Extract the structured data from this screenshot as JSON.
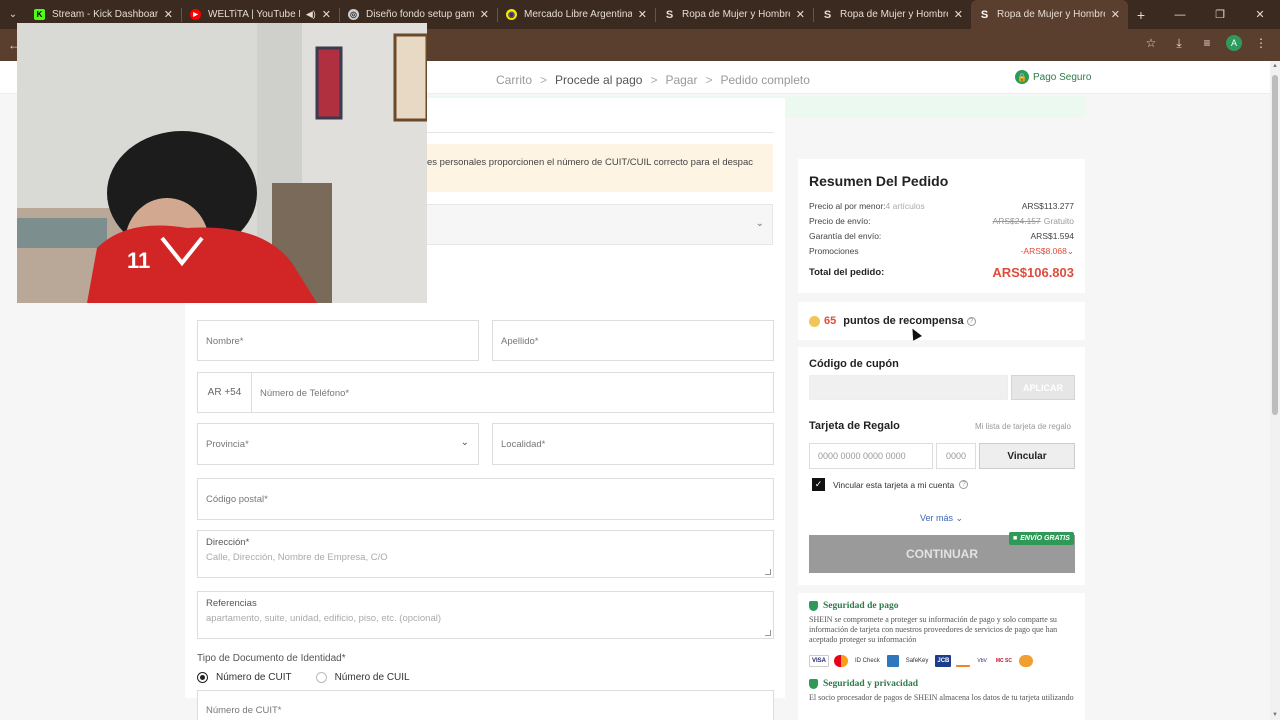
{
  "browser": {
    "tabs": [
      {
        "title": "Stream - Kick Dashboard",
        "icon": "kick-icon",
        "color": "#53fc18",
        "glyph": "K"
      },
      {
        "title": "WELTiTA | YouTube Music",
        "icon": "youtube-music-icon",
        "color": "#ff0000",
        "glyph": "▶"
      },
      {
        "title": "Diseño fondo setup gamer",
        "icon": "openai-icon",
        "color": "#cfcfcf",
        "glyph": "◎"
      },
      {
        "title": "Mercado Libre Argentina - Don",
        "icon": "mercadolibre-icon",
        "color": "#ffe600",
        "glyph": "◉"
      },
      {
        "title": "Ropa de Mujer y Hombre, Com",
        "icon": "shein-icon",
        "color": "#222222",
        "glyph": "S"
      },
      {
        "title": "Ropa de Mujer y Hombre, Com",
        "icon": "shein-icon",
        "color": "#222222",
        "glyph": "S"
      },
      {
        "title": "Ropa de Mujer y Hombre, Com",
        "icon": "shein-icon",
        "color": "#222222",
        "glyph": "S"
      }
    ]
  },
  "header": {
    "secure_label": "Pago Seguro"
  },
  "breadcrumb": {
    "steps": [
      "Carrito",
      "Procede al pago",
      "Pagar",
      "Pedido completo"
    ],
    "separator": ">"
  },
  "form": {
    "notice": "es personales proporcionen el número de CUIT/CUIL correcto para el despac",
    "nombre_label": "Nombre*",
    "apellido_label": "Apellido*",
    "phone_prefix": "AR +54",
    "phone_label": "Número de Teléfono*",
    "provincia_label": "Provincia*",
    "localidad_label": "Localidad*",
    "postal_label": "Código postal*",
    "direccion_label": "Dirección*",
    "direccion_placeholder": "Calle, Dirección, Nombre de Empresa, C/O",
    "referencias_label": "Referencias",
    "referencias_placeholder": "apartamento, suite, unidad, edificio, piso, etc. (opcional)",
    "doc_type_label": "Tipo de Documento de Identidad*",
    "doc_options": [
      "Número de CUIT",
      "Número de CUIL"
    ],
    "doc_selected": "Número de CUIT",
    "cuit_label": "Número de CUIT*"
  },
  "summary": {
    "title": "Resumen Del Pedido",
    "retail_label": "Precio al por menor:",
    "retail_count": "4 artículos",
    "retail_value": "ARS$113.277",
    "shipping_label": "Precio de envío:",
    "shipping_old": "ARS$24.157",
    "shipping_value": "Gratuito",
    "warranty_label": "Garantía del envío:",
    "warranty_value": "ARS$1.594",
    "promo_label": "Promociones",
    "promo_value": "-ARS$8.068",
    "total_label": "Total del pedido:",
    "total_value": "ARS$106.803"
  },
  "points": {
    "count": "65",
    "label": "puntos de recompensa"
  },
  "coupon": {
    "title": "Código de cupón",
    "apply_label": "APLICAR"
  },
  "gift": {
    "title": "Tarjeta de Regalo",
    "list_link": "Mi lista de tarjeta de regalo",
    "number_placeholder": "0000 0000 0000 0000",
    "pin_placeholder": "0000",
    "link_button": "Vincular",
    "checkbox_label": "Vincular esta tarjeta a mi cuenta",
    "more_label": "Ver más",
    "free_shipping_badge": "ENVÍO GRATIS",
    "continue_label": "CONTINUAR"
  },
  "security": {
    "pay_title": "Seguridad de pago",
    "pay_text": "SHEIN se compromete a proteger su información de pago y solo comparte su información de tarjeta con nuestros proveedores de servicios de pago que han aceptado proteger su información",
    "privacy_title": "Seguridad y privacidad",
    "privacy_text": "El socio procesador de pagos de SHEIN almacena los datos de tu tarjeta utilizando",
    "logos": [
      "VISA",
      "MC",
      "ID Check",
      "AMEX",
      "SafeKey",
      "JCB",
      "Discover",
      "Verified by VISA",
      "MasterCard SecureCode",
      "Diners"
    ]
  },
  "colors": {
    "accent_green": "#2f9a58",
    "price_red": "#e04b3c",
    "browser_brown": "#5a3e2e"
  }
}
